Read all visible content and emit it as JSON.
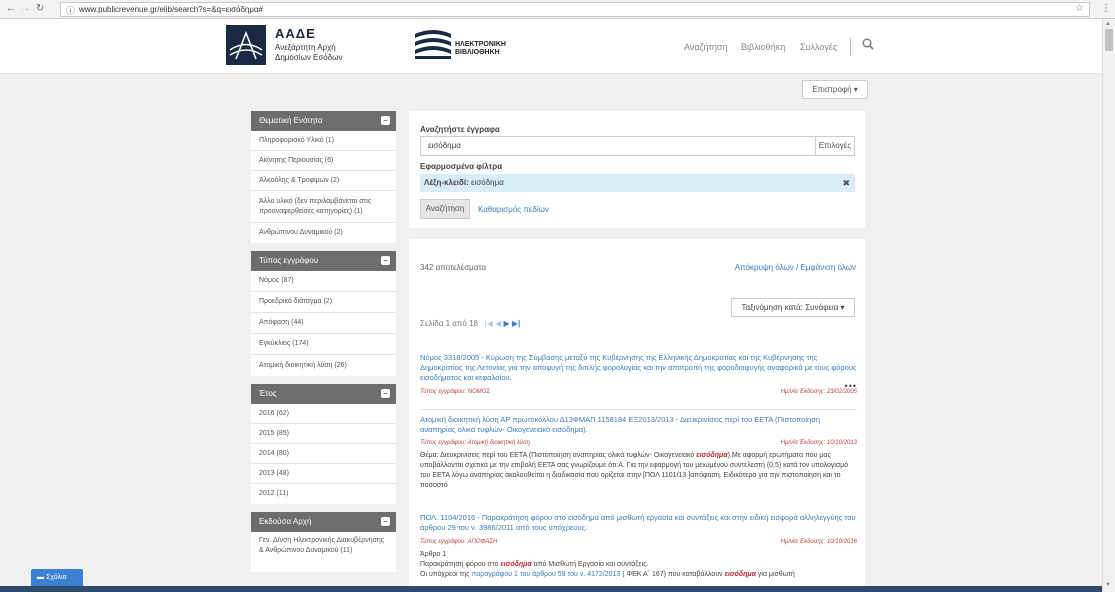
{
  "browser": {
    "url": "www.publicrevenue.gr/elib/search?s=&q=εισόδημα#"
  },
  "header": {
    "logo_title": "ΑΑΔΕ",
    "logo_sub": "Ανεξάρτητη Αρχή Δημοσίων Εσόδων",
    "lib_line1": "ΗΛΕΚΤΡΟΝΙΚΗ",
    "lib_line2": "ΒΙΒΛΙΟΘΗΚΗ",
    "nav": [
      "Αναζήτηση",
      "Βιβλιοθήκη",
      "Συλλογές"
    ]
  },
  "back_button": "Επιστροφή ▾",
  "sidebar": {
    "facets": [
      {
        "title": "Θεματική Ενότητα",
        "items": [
          "Πληροφοριακό Υλικό (1)",
          "Ακίνητης Περιουσίας (6)",
          "Αλκοόλης & Τροφίμων (2)",
          "Άλλο υλικό (δεν περιλαμβάνεται στις προαναφερθείσες κατηγορίες) (1)",
          "Ανθρώπινου Δυναμικού (2)"
        ]
      },
      {
        "title": "Τύπος εγγράφου",
        "items": [
          "Νόμος (87)",
          "Προεδρικό διάταγμα (2)",
          "Απόφαση (44)",
          "Εγκύκλιος (174)",
          "Ατομική διοικητική λύση (26)"
        ]
      },
      {
        "title": "Έτος",
        "items": [
          "2016 (62)",
          "2015 (85)",
          "2014 (80)",
          "2013 (48)",
          "2012 (11)"
        ]
      },
      {
        "title": "Εκδούσα Αρχή",
        "items": [
          "Γεν. Δ/νση Ηλεκτρονικής Διακυβέρνησης & Ανθρώπινου Δυναμικού (11)"
        ]
      }
    ]
  },
  "search": {
    "title": "Αναζητήστε έγγραφα",
    "query": "εισόδημα",
    "options_label": "Επιλογές",
    "filters_title": "Εφαρμοσμένα φίλτρα",
    "filter_key": "Λέξη-κλειδί:",
    "filter_value": "εισόδημα",
    "search_button": "Αναζήτηση",
    "clear_link": "Καθαρισμός πεδίων"
  },
  "results": {
    "count": "342 αποτελέσματα",
    "toggle": "Απόκρυψη όλων / Εμφάνιση όλων",
    "sort": "Ταξινόμηση κατά: Συνάφεια ▾",
    "page_info": "Σελίδα 1 από 18",
    "items": [
      {
        "title": "Νόμος 3318/2005 - Κύρωση της Σύμβασης μεταξύ της Κυβέρνησης της Ελληνικής Δημοκρατίας και της Κυβέρνησης της Δημοκρατίας της Λετονίας για την αποφυγή της διπλής φορολογίας και την αποτροπή της φοροδιαφυγής αναφορικά με τους φόρους εισοδήματος και κεφαλαίου.",
        "type": "Τύπος εγγράφου: ΝΟΜΟΣ",
        "date": "Ημ/νία Έκδοσης: 23/02/2005"
      },
      {
        "title": "Ατομική διοικητική λύση ΑΡ πρωτοκόλλου Δ13ΦΜΑΠ 1158184 ΕΞ2013/2013 - Διευκρινίσεις περί του ΕΕΤΑ (Πιστοποίηση αναπηρίας ολικά τυφλών- Οικογενειακό εισόδημα).",
        "type": "Τύπος εγγράφου: Ατομική διοικητική λύση",
        "date": "Ημ/νία Έκδοσης: 10/10/2013",
        "body_pre": "Θέμα: Διευκρινίσεις περί του ΕΕΤΑ (Πιστοποίηση αναπηρίας ολικά τυφλών- Οικογενειακό ",
        "body_hl": "εισόδημα",
        "body_post": ").Με αφορμή ερωτήματα που μας υποβάλλονται σχετικά με την επιβολή ΕΕΤΑ σας γνωρίζουμε ότι:Α. Για την εφαρμογή του μειωμένου συντελεστή (0,5) κατά τον υπολογισμό του ΕΕΤΑ λόγω αναπηρίας ακολουθείται η διαδικασία που ορίζεται στην [ΠΟΛ 1101/13 ]απόφαση. Ειδικότερα για την πιστοποίηση και το ποσοστό"
      },
      {
        "title": "ΠΟΛ. 1104/2016 - Παρακράτηση φόρου στο εισόδημα από μισθωτή εργασία και συντάξεις και στην ειδική εισφορά αλληλεγγύης του άρθρου 29 του ν. 3986/2011 από τους υπόχρεους.",
        "type": "Τύπος εγγράφου: ΑΠΟΦΑΣΗ",
        "date": "Ημ/νία Έκδοσης: 10/10/2016",
        "line1": "Άρθρο 1",
        "line2_pre": "Παρακράτηση φόρου στο ",
        "line2_hl": "εισόδημα",
        "line2_post": " από Μισθωτή Εργασία και συντάξεις.",
        "line3_pre": "Οι υπόχρεοι της ",
        "line3_link": "παραγράφου 1 του άρθρου 59 του ν. 4172/2013",
        "line3_mid": " ( ΦΕΚ Α΄ 167) που καταβάλλουν ",
        "line3_hl": "εισόδημα",
        "line3_post": " για μισθωτή"
      }
    ]
  },
  "comments_button": "Σχόλια"
}
